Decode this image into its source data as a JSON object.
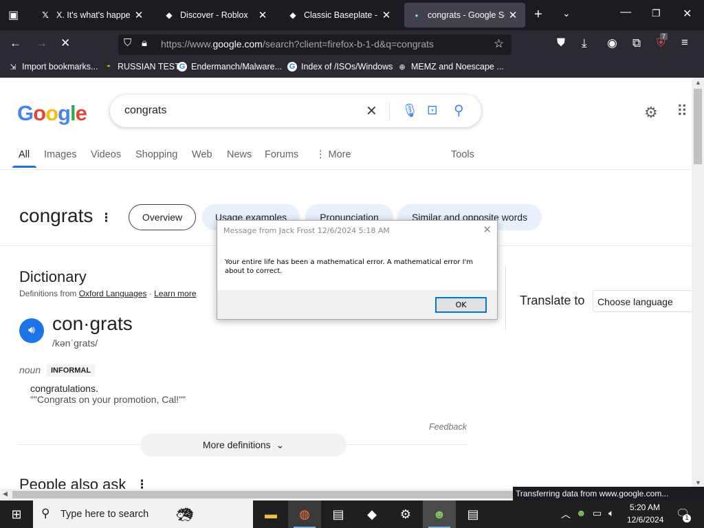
{
  "browser": {
    "tabs": [
      {
        "title": "X. It's what's happening",
        "favicon": "x-logo-icon"
      },
      {
        "title": "Discover - Roblox",
        "favicon": "roblox-icon"
      },
      {
        "title": "Classic Baseplate - Robl",
        "favicon": "roblox-icon"
      },
      {
        "title": "congrats - Google Searc",
        "favicon": "google-icon",
        "active": true
      }
    ],
    "url_prefix": "https://www.",
    "url_domain": "google.com",
    "url_rest": "/search?client=firefox-b-1-d&q=congrats",
    "extension_badge": "7",
    "bookmarks": [
      {
        "label": "Import bookmarks...",
        "icon": "import-icon"
      },
      {
        "label": "RUSSIAN TEST",
        "icon": "site-icon"
      },
      {
        "label": "Endermanch/Malware...",
        "icon": "google-icon"
      },
      {
        "label": "Index of /ISOs/Windows",
        "icon": "google-icon"
      },
      {
        "label": "MEMZ and Noescape ...",
        "icon": "globe-icon"
      }
    ],
    "status_text": "Transferring data from www.google.com..."
  },
  "google": {
    "query": "congrats",
    "tabs": [
      "All",
      "Images",
      "Videos",
      "Shopping",
      "Web",
      "News",
      "Forums",
      "More"
    ],
    "tools_label": "Tools",
    "word": "congrats",
    "chips": [
      "Overview",
      "Usage examples",
      "Pronunciation",
      "Similar and opposite words"
    ],
    "dictionary": {
      "heading": "Dictionary",
      "source_prefix": "Definitions from ",
      "source_link": "Oxford Languages",
      "source_sep": " · ",
      "learn_more": "Learn more",
      "headword": "con·grats",
      "phonetic": "/kənˈɡrats/",
      "part_of_speech": "noun",
      "register": "INFORMAL",
      "definition": "congratulations.",
      "example": "\"\"Congrats on your promotion, Cal!\"\"",
      "feedback": "Feedback",
      "more_definitions": "More definitions"
    },
    "translate": {
      "label": "Translate to",
      "select_value": "Choose language"
    },
    "people_also_ask": "People also ask"
  },
  "dialog": {
    "title": "Message from Jack Frost 12/6/2024 5:18 AM",
    "message": "Your entire life has been a mathematical error. A mathematical error I'm about to correct.",
    "ok_label": "OK"
  },
  "taskbar": {
    "search_placeholder": "Type here to search",
    "time": "5:20 AM",
    "date": "12/6/2024",
    "notification_count": "1"
  },
  "colors": {
    "google_blue": "#1a73e8",
    "chip_bg": "#e8f0fe",
    "browser_dark": "#1c1b22"
  }
}
